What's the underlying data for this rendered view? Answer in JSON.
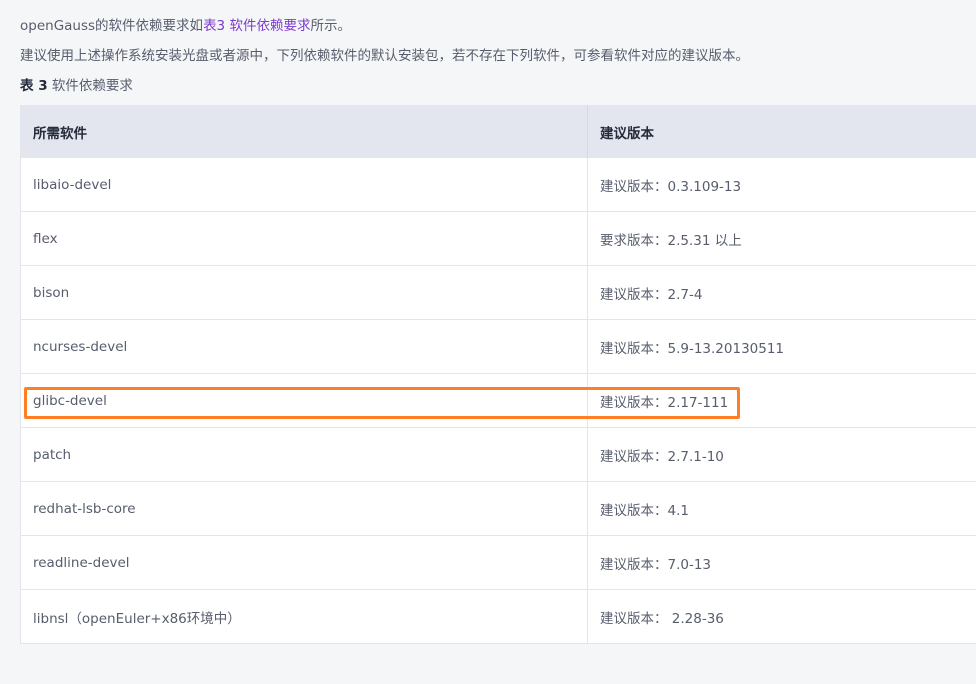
{
  "intro": {
    "prefix": "openGauss的软件依赖要求如",
    "link_text": "表3 软件依赖要求",
    "suffix": "所示。"
  },
  "note": "建议使用上述操作系统安装光盘或者源中，下列依赖软件的默认安装包，若不存在下列软件，可参看软件对应的建议版本。",
  "caption": {
    "label": "表 3",
    "title": "软件依赖要求"
  },
  "table": {
    "headers": [
      "所需软件",
      "建议版本"
    ],
    "rows": [
      [
        "libaio-devel",
        "建议版本：0.3.109-13"
      ],
      [
        "flex",
        "要求版本：2.5.31 以上"
      ],
      [
        "bison",
        "建议版本：2.7-4"
      ],
      [
        "ncurses-devel",
        "建议版本：5.9-13.20130511"
      ],
      [
        "glibc-devel",
        "建议版本：2.17-111"
      ],
      [
        "patch",
        "建议版本：2.7.1-10"
      ],
      [
        "redhat-lsb-core",
        "建议版本：4.1"
      ],
      [
        "readline-devel",
        "建议版本：7.0-13"
      ],
      [
        "libnsl（openEuler+x86环境中）",
        "建议版本： 2.28-36"
      ]
    ]
  },
  "highlight_color": "#ff7f27",
  "link_color": "#7d3bd1"
}
